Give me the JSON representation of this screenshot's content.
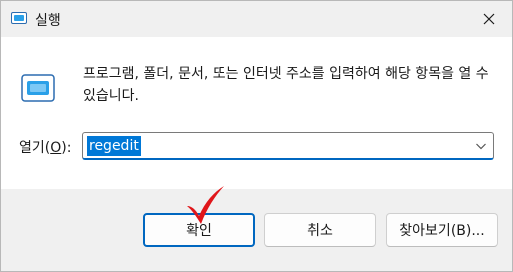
{
  "window": {
    "title": "실행",
    "icon": "run-dialog-icon",
    "close_icon": "close-icon"
  },
  "content": {
    "description": "프로그램, 폴더, 문서, 또는 인터넷 주소를 입력하여 해당 항목을 열 수 있습니다.",
    "open_label_prefix": "열기(",
    "open_label_hotkey": "O",
    "open_label_suffix": "):",
    "open_value": "regedit"
  },
  "buttons": {
    "ok": "확인",
    "cancel": "취소",
    "browse": "찾아보기(B)..."
  },
  "colors": {
    "accent": "#0067c0",
    "selection": "#0078d7",
    "checkmark": "#e0161a"
  }
}
